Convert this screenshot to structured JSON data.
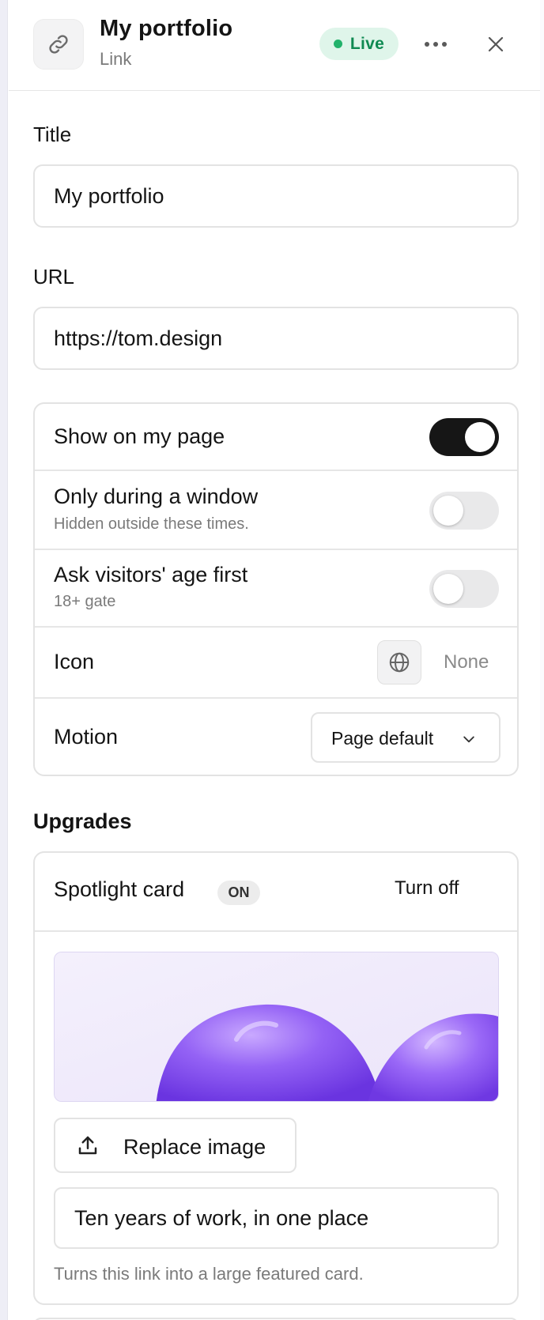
{
  "header": {
    "title": "My portfolio",
    "subtitle": "Link",
    "status": "Live",
    "icon": "link-icon"
  },
  "fields": {
    "title_label": "Title",
    "title_value": "My portfolio",
    "url_label": "URL",
    "url_value": "https://tom.design"
  },
  "settings": {
    "show_on_page": {
      "label": "Show on my page",
      "enabled": true
    },
    "schedule": {
      "label": "Only during a window",
      "description": "Hidden outside these times.",
      "enabled": false
    },
    "age_gate": {
      "label": "Ask visitors' age first",
      "description": "18+ gate",
      "enabled": false
    },
    "icon": {
      "label": "Icon",
      "value": "None",
      "picker_icon": "globe-icon"
    },
    "motion": {
      "label": "Motion",
      "value": "Page default"
    }
  },
  "upgrades": {
    "section_title": "Upgrades",
    "spotlight": {
      "title": "Spotlight card",
      "badge": "ON",
      "action": "Turn off",
      "replace_label": "Replace image",
      "caption_value": "Ten years of work, in one place",
      "help": "Turns this link into a large featured card."
    }
  },
  "colors": {
    "live_bg": "#dff5ea",
    "live_text": "#0f8a52",
    "toggle_on": "#161616",
    "toggle_off": "#e9e9ea",
    "accent_purple": "#7c4dff"
  }
}
